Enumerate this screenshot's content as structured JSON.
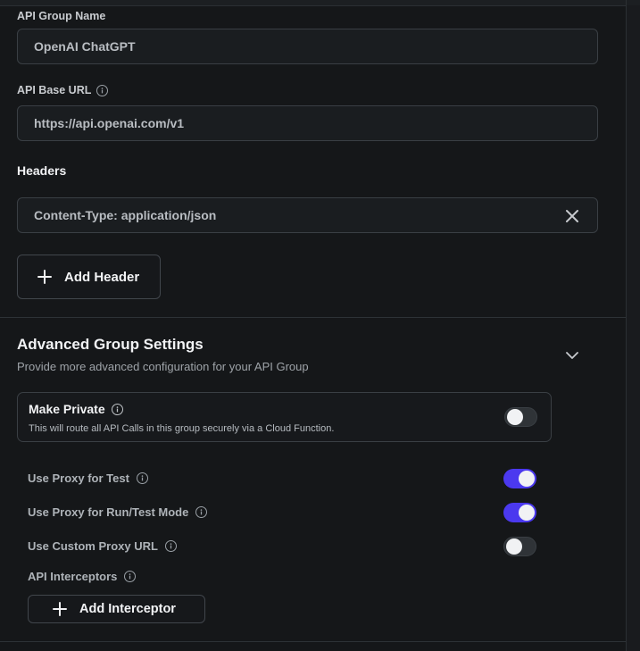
{
  "api_group_name": {
    "label": "API Group Name",
    "value": "OpenAI ChatGPT"
  },
  "api_base_url": {
    "label": "API Base URL",
    "value": "https://api.openai.com/v1"
  },
  "headers": {
    "label": "Headers",
    "items": [
      {
        "value": "Content-Type: application/json"
      }
    ],
    "add_label": "Add Header"
  },
  "advanced": {
    "title": "Advanced Group Settings",
    "subtitle": "Provide more advanced configuration for your API Group",
    "make_private": {
      "label": "Make Private",
      "description": "This will route all API Calls in this group securely via a Cloud Function.",
      "enabled": false
    },
    "options": [
      {
        "label": "Use Proxy for Test",
        "enabled": true
      },
      {
        "label": "Use Proxy for Run/Test Mode",
        "enabled": true
      },
      {
        "label": "Use Custom Proxy URL",
        "enabled": false
      }
    ],
    "interceptors": {
      "label": "API Interceptors",
      "add_label": "Add Interceptor"
    }
  },
  "colors": {
    "accent": "#4b39ef",
    "background": "#151719"
  }
}
